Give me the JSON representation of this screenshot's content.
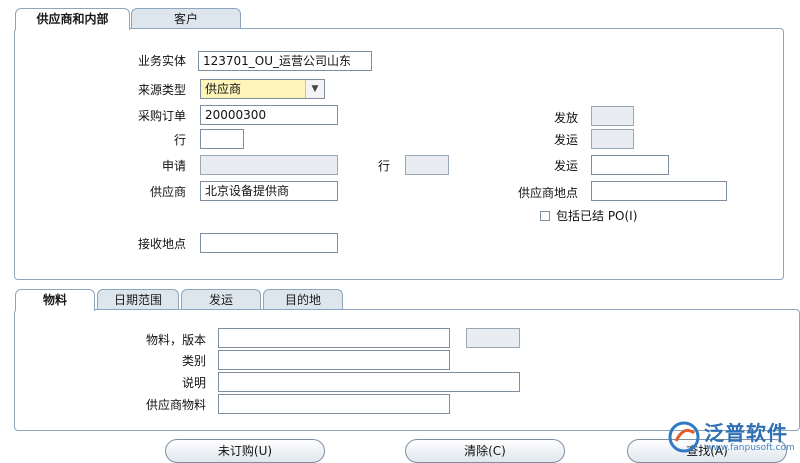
{
  "top_tabs": [
    "供应商和内部",
    "客户"
  ],
  "header_form": {
    "business_entity_label": "业务实体",
    "business_entity_value": "123701_OU_运营公司山东",
    "source_type_label": "来源类型",
    "source_type_value": "供应商",
    "po_label": "采购订单",
    "po_value": "20000300",
    "line_label": "行",
    "line_value": "",
    "release_label": "发放",
    "release_value": "",
    "shipment_label": "发运",
    "shipment_value": "",
    "request_label": "申请",
    "request_value": "",
    "request_line_label": "行",
    "request_line_value": "",
    "shipment2_label": "发运",
    "shipment2_value": "",
    "supplier_label": "供应商",
    "supplier_value": "北京设备提供商",
    "supplier_site_label": "供应商地点",
    "supplier_site_value": "",
    "include_closed_label": "包括已结 PO(I)",
    "receiving_location_label": "接收地点",
    "receiving_location_value": ""
  },
  "bottom_tabs": [
    "物料",
    "日期范围",
    "发运",
    "目的地"
  ],
  "item_form": {
    "item_revision_label": "物料，版本",
    "item_value": "",
    "revision_value": "",
    "category_label": "类别",
    "category_value": "",
    "description_label": "说明",
    "description_value": "",
    "supplier_item_label": "供应商物料",
    "supplier_item_value": ""
  },
  "buttons": {
    "unordered": "未订购(U)",
    "clear": "清除(C)",
    "find": "查找(A)"
  },
  "logo": {
    "text": "泛普软件",
    "url": "www.fanpusoft.com"
  }
}
